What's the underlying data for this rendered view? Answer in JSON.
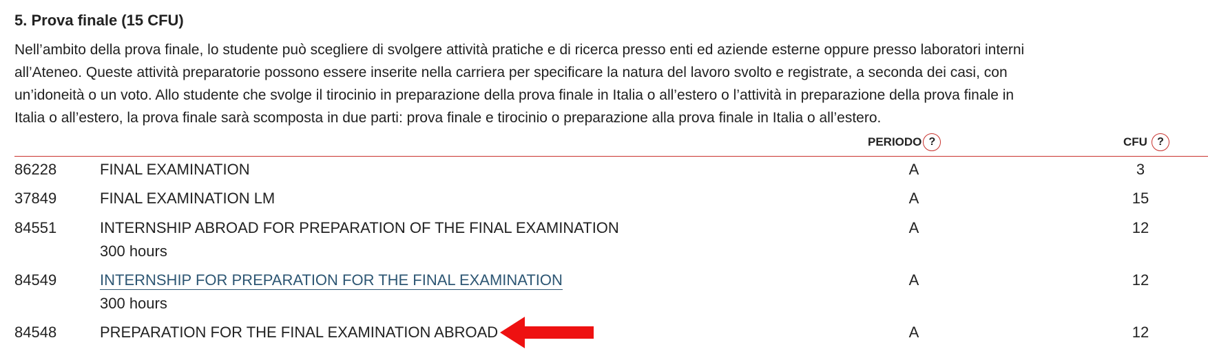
{
  "section": {
    "title": "5. Prova finale (15 CFU)",
    "description_lines": [
      "Nell’ambito della prova finale, lo studente può scegliere di svolgere attività pratiche e di ricerca presso enti ed aziende esterne oppure presso laboratori interni",
      "all’Ateneo. Queste attività preparatorie possono essere inserite nella carriera per specificare la natura del lavoro svolto e registrate, a seconda dei casi, con",
      "un’idoneità o un voto. Allo studente che svolge il tirocinio in preparazione della prova finale in Italia o all’estero o l’attività in preparazione della prova finale in",
      "Italia o all’estero, la prova finale sarà scomposta in due parti: prova finale e tirocinio o preparazione alla prova finale in Italia o all’estero."
    ]
  },
  "table": {
    "headers": {
      "periodo": "PERIODO",
      "cfu": "CFU",
      "help_symbol": "?"
    },
    "rows": [
      {
        "code": "86228",
        "name": "FINAL EXAMINATION",
        "note": "",
        "periodo": "A",
        "cfu": "3",
        "is_link": false
      },
      {
        "code": "37849",
        "name": "FINAL EXAMINATION LM",
        "note": "",
        "periodo": "A",
        "cfu": "15",
        "is_link": false
      },
      {
        "code": "84551",
        "name": "INTERNSHIP ABROAD FOR PREPARATION OF THE FINAL EXAMINATION",
        "note": "300 hours",
        "periodo": "A",
        "cfu": "12",
        "is_link": false
      },
      {
        "code": "84549",
        "name": "INTERNSHIP FOR PREPARATION FOR THE FINAL EXAMINATION",
        "note": "300 hours",
        "periodo": "A",
        "cfu": "12",
        "is_link": true
      },
      {
        "code": "84548",
        "name": "PREPARATION FOR THE FINAL EXAMINATION ABROAD",
        "note": "",
        "periodo": "A",
        "cfu": "12",
        "is_link": false
      }
    ]
  },
  "annotation": {
    "icon": "red-left-arrow-icon",
    "color": "#ee1111"
  },
  "colors": {
    "accent_rule": "#c8312c",
    "link": "#2d5673",
    "text": "#222222"
  }
}
